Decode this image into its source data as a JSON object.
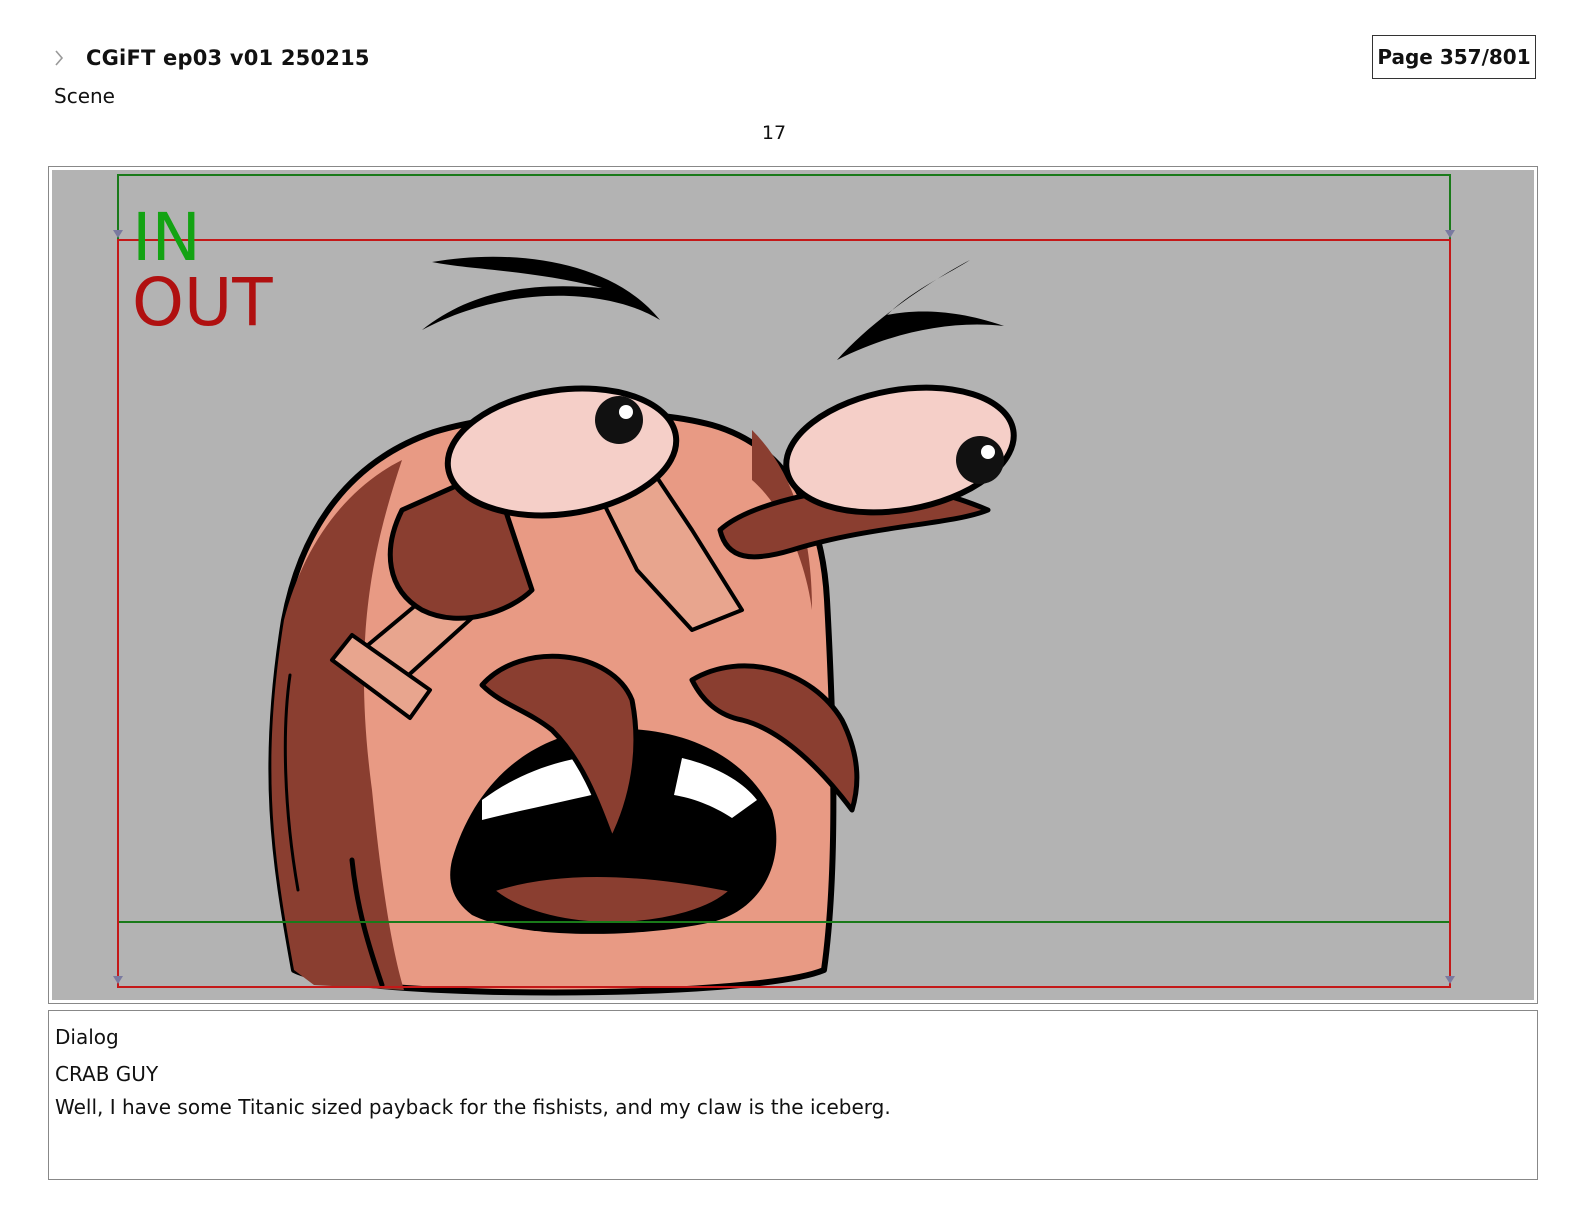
{
  "header": {
    "title": "CGiFT ep03 v01 250215",
    "page": "Page 357/801",
    "section_label": "Scene",
    "scene_number": "17"
  },
  "panel": {
    "in_label": "IN",
    "out_label": "OUT",
    "colors": {
      "background": "#b3b3b3",
      "in_frame": "#1a7a1a",
      "out_frame": "#c41818",
      "in_text": "#13a313",
      "out_text": "#b01010",
      "skin_light": "#e89a84",
      "skin_dark": "#8a3e30",
      "eye_white": "#f5cfc8"
    }
  },
  "dialog": {
    "label": "Dialog",
    "character": "CRAB GUY",
    "line": "Well, I have some Titanic sized payback for the fishists, and my claw is the iceberg."
  }
}
